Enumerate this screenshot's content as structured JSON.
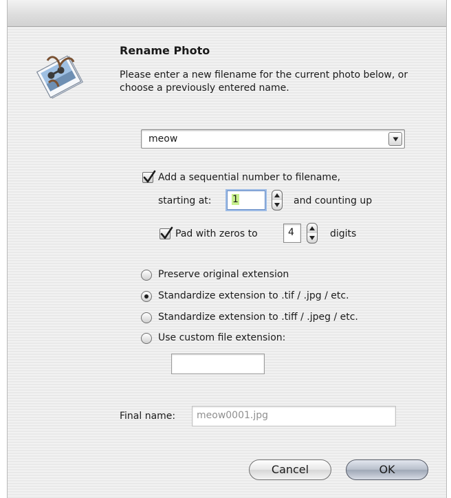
{
  "dialog": {
    "title": "Rename Photo",
    "description": "Please enter a new filename for the current photo below, or choose a previously entered name."
  },
  "filename": {
    "value": "meow"
  },
  "sequential": {
    "checked": true,
    "label": "Add a sequential number to filename,",
    "starting_label": "starting at:",
    "start_value": "1",
    "counting_label": "and counting up"
  },
  "pad": {
    "checked": true,
    "label": "Pad with zeros to",
    "digits_value": "4",
    "digits_label": "digits"
  },
  "extension_options": [
    {
      "label": "Preserve original extension",
      "selected": false
    },
    {
      "label": "Standardize extension to .tif / .jpg / etc.",
      "selected": true
    },
    {
      "label": "Standardize extension to .tiff / .jpeg / etc.",
      "selected": false
    },
    {
      "label": "Use custom file extension:",
      "selected": false
    }
  ],
  "custom_extension": {
    "value": ""
  },
  "final_name": {
    "label": "Final name:",
    "value": "meow0001.jpg"
  },
  "buttons": {
    "cancel": "Cancel",
    "ok": "OK"
  },
  "icons": {
    "app": "iphoto-app-icon",
    "combo_arrow": "chevron-down-icon",
    "check": "checkmark-icon"
  }
}
